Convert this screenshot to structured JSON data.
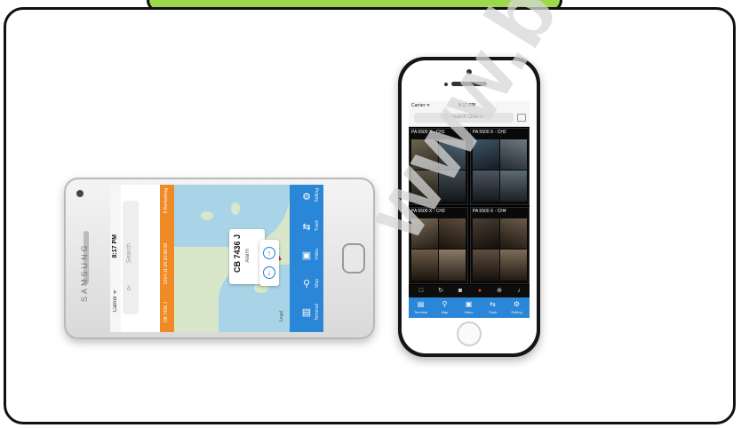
{
  "banner": {
    "text": ""
  },
  "watermark": {
    "text": "www.be"
  },
  "samsung": {
    "brand": "SAMSUNG",
    "status": {
      "carrier": "Carrier ᯤ",
      "time": "8:17 PM"
    },
    "search": {
      "placeholder": "Search",
      "icon": "search-icon"
    },
    "alert_bar": {
      "id": "CB 7436 J",
      "datetime": "2014-11-24 20:58:08",
      "ref": "5 Refreshing"
    },
    "map_popup": {
      "title": "CB 7436 J",
      "subtitle": "Alarm"
    },
    "zoom": {
      "in": "↑",
      "out": "↓"
    },
    "map_logo": "Legal",
    "tabs": [
      {
        "label": "Setting",
        "icon": "gear-icon",
        "glyph": "⚙"
      },
      {
        "label": "Track",
        "icon": "track-icon",
        "glyph": "⇆"
      },
      {
        "label": "Video",
        "icon": "video-icon",
        "glyph": "▣"
      },
      {
        "label": "Map",
        "icon": "map-pin-icon",
        "glyph": "⚲"
      },
      {
        "label": "Terminal",
        "icon": "terminal-icon",
        "glyph": "▤"
      }
    ]
  },
  "iphone": {
    "status": {
      "carrier": "Carrier ᯤ",
      "time": "8:17 PM"
    },
    "search": {
      "placeholder": "Q  Search Online",
      "icon": "book-icon"
    },
    "cameras": [
      {
        "label": "PA 5500 X - CH1"
      },
      {
        "label": "PA 5500 X - CH2"
      },
      {
        "label": "PA 5500 X - CH3"
      },
      {
        "label": "PA 5500 X - CH4"
      }
    ],
    "controls": [
      {
        "icon": "stop-icon",
        "glyph": "□"
      },
      {
        "icon": "refresh-icon",
        "glyph": "↻"
      },
      {
        "icon": "camera-icon",
        "glyph": "◙"
      },
      {
        "icon": "record-icon",
        "glyph": "●"
      },
      {
        "icon": "plus-icon",
        "glyph": "⊕"
      },
      {
        "icon": "mic-icon",
        "glyph": "♪"
      }
    ],
    "tabs": [
      {
        "label": "Terminal",
        "icon": "terminal-icon",
        "glyph": "▤"
      },
      {
        "label": "Map",
        "icon": "map-pin-icon",
        "glyph": "⚲"
      },
      {
        "label": "Video",
        "icon": "video-icon",
        "glyph": "▣"
      },
      {
        "label": "Track",
        "icon": "track-icon",
        "glyph": "⇆"
      },
      {
        "label": "Setting",
        "icon": "gear-icon",
        "glyph": "⚙"
      }
    ]
  },
  "colors": {
    "banner": "#9bd94a",
    "tabbar": "#2a86d6",
    "alert": "#f08a24",
    "water": "#a9d4e8",
    "land": "#d8e7c9"
  }
}
